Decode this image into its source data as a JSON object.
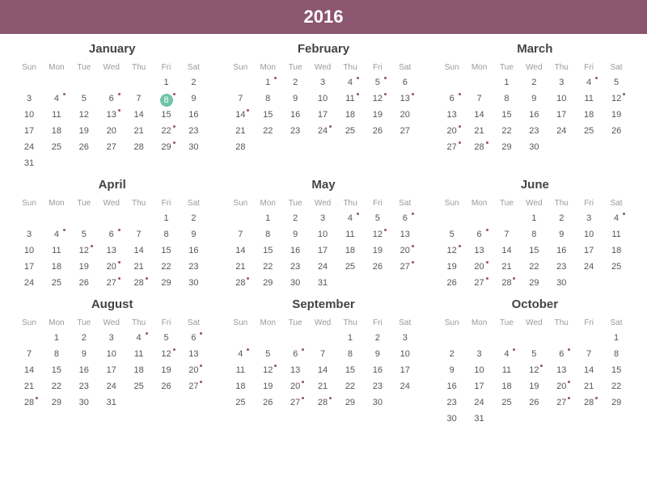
{
  "year": "2016",
  "dow": [
    "Sun",
    "Mon",
    "Tue",
    "Wed",
    "Thu",
    "Fri",
    "Sat"
  ],
  "selected": {
    "month": 0,
    "day": 8
  },
  "months": [
    {
      "name": "January",
      "start": 5,
      "days": 31,
      "marked": [
        4,
        6,
        8,
        13,
        22,
        29
      ]
    },
    {
      "name": "February",
      "start": 1,
      "days": 28,
      "marked": [
        1,
        4,
        5,
        11,
        12,
        13,
        14,
        24
      ]
    },
    {
      "name": "March",
      "start": 2,
      "days": 30,
      "marked": [
        4,
        6,
        12,
        20,
        27,
        28
      ]
    },
    {
      "name": "April",
      "start": 5,
      "days": 30,
      "marked": [
        4,
        6,
        12,
        20,
        27,
        28
      ]
    },
    {
      "name": "May",
      "start": 1,
      "days": 31,
      "marked": [
        4,
        6,
        12,
        20,
        27,
        28
      ]
    },
    {
      "name": "June",
      "start": 3,
      "days": 30,
      "marked": [
        4,
        6,
        12,
        20,
        27,
        28
      ]
    },
    {
      "name": "August",
      "start": 1,
      "days": 31,
      "marked": [
        4,
        6,
        12,
        20,
        27,
        28
      ]
    },
    {
      "name": "September",
      "start": 4,
      "days": 30,
      "marked": [
        4,
        6,
        12,
        20,
        27,
        28
      ]
    },
    {
      "name": "October",
      "start": 6,
      "days": 31,
      "marked": [
        4,
        6,
        12,
        20,
        27,
        28
      ]
    }
  ]
}
